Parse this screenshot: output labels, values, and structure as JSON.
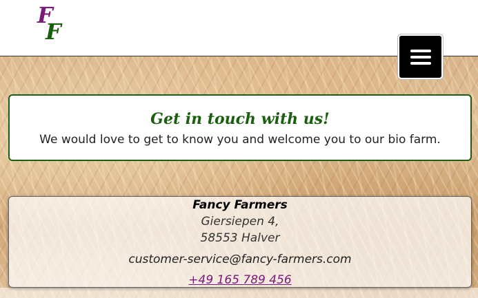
{
  "logo": {
    "top_letter": "F",
    "bottom_letter": "F",
    "top_color": "#7a1a7a",
    "bottom_color": "#1b5e10"
  },
  "menu": {
    "icon": "hamburger-icon"
  },
  "contact": {
    "title": "Get in touch with us!",
    "subtitle": "We would love to get to know you and welcome you to our bio farm.",
    "title_color": "#1b5e10"
  },
  "address": {
    "company": "Fancy Farmers",
    "street": "Giersiepen 4,",
    "city": "58553 Halver",
    "email": "customer-service@fancy-farmers.com",
    "phone": "+49 165 789 456",
    "phone_color": "#7a1a7a"
  }
}
